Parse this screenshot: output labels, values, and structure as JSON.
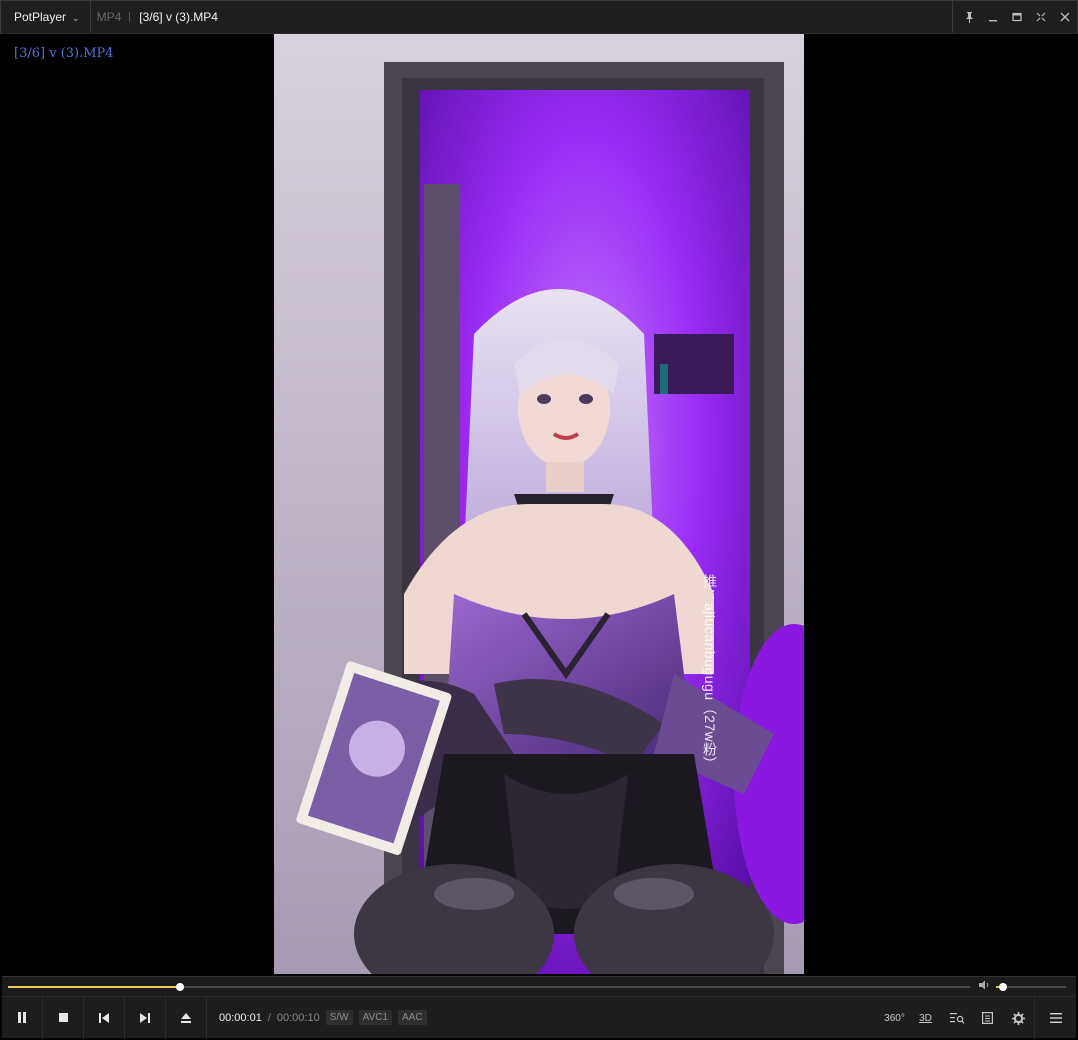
{
  "titlebar": {
    "app_name": "PotPlayer",
    "format": "MP4",
    "title": "[3/6] v (3).MP4"
  },
  "osd": {
    "text": "[3/6] v (3).MP4"
  },
  "video": {
    "watermark": "推：ajiucanbugugu（27w粉）",
    "colors": {
      "neon": "#9b2cff",
      "wall": "#c8bfd0",
      "door_frame": "#4b4550"
    }
  },
  "playback": {
    "progress": 0.179,
    "volume": 0.1,
    "current_time": "00:00:01",
    "separator": "/",
    "total_time": "00:00:10",
    "badges": [
      "S/W",
      "AVC1",
      "AAC"
    ],
    "accent_color": "#e8c95a"
  },
  "tools": {
    "vr_label": "360°",
    "stereo_label": "3D"
  },
  "icons": {
    "app_menu": "chevron-down-icon",
    "pin": "pin-icon",
    "minimize": "minimize-icon",
    "maximize": "maximize-icon",
    "fullscreen": "fullscreen-icon",
    "close": "close-icon",
    "pause": "pause-icon",
    "stop": "stop-icon",
    "prev": "previous-icon",
    "next": "next-icon",
    "eject": "eject-icon",
    "volume": "speaker-icon",
    "playlist_search": "playlist-search-icon",
    "chapters": "chapter-list-icon",
    "settings": "gear-icon",
    "main_menu": "hamburger-menu-icon"
  }
}
